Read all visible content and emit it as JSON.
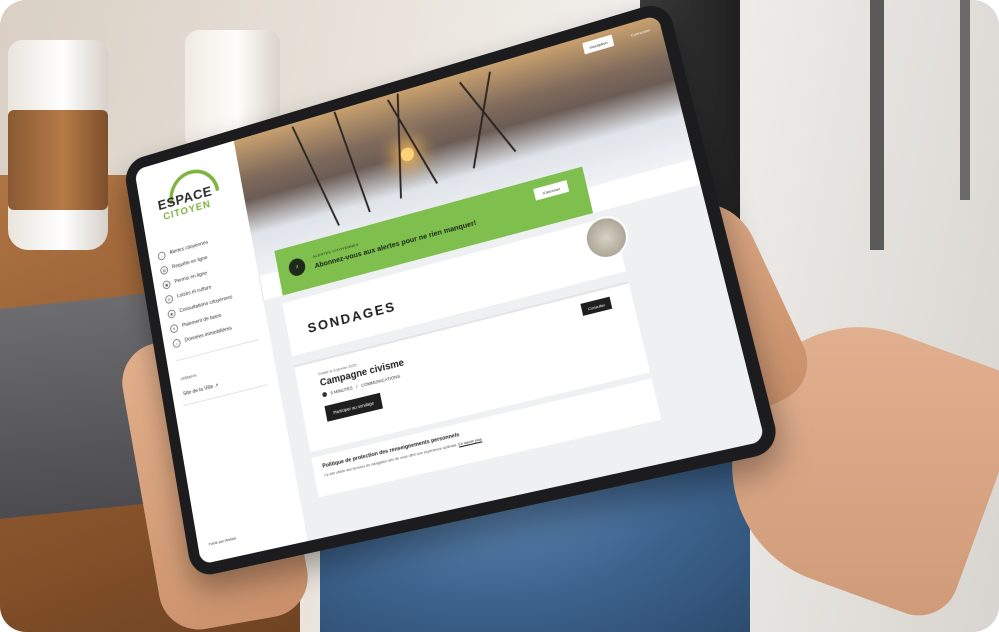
{
  "header": {
    "register_label": "Inscription",
    "login_label": "Connexion"
  },
  "logo": {
    "line1": "ESPACE",
    "line2": "CITOYEN"
  },
  "sidebar": {
    "items": [
      {
        "label": "Alertes citoyennes",
        "icon": "bell-icon"
      },
      {
        "label": "Requête en ligne",
        "icon": "document-icon"
      },
      {
        "label": "Permis en ligne",
        "icon": "permit-icon"
      },
      {
        "label": "Loisirs et culture",
        "icon": "leisure-icon"
      },
      {
        "label": "Consultations citoyennes",
        "icon": "consultation-icon"
      },
      {
        "label": "Paiement de taxes",
        "icon": "payment-icon"
      },
      {
        "label": "Données immobilières",
        "icon": "building-icon"
      }
    ],
    "section_label": "Utilitaires",
    "site_link": "Site de la Ville ↗",
    "footer_credit": "Fuelé par Webbit"
  },
  "alert": {
    "kicker": "ALERTES CITOYENNES",
    "title": "Abonnez-vous aux alertes pour ne rien manquer!",
    "button_label": "S'abonner"
  },
  "main": {
    "section_title": "SONDAGES",
    "poll": {
      "date": "Publié le 8 janvier 2025",
      "title": "Campagne civisme",
      "duration": "5 MINUTES",
      "separator": "/",
      "category": "COMMUNICATIONS",
      "participate_label": "Participer au sondage",
      "close_label": "Consulter"
    },
    "privacy": {
      "title": "Politique de protection des renseignements personnels",
      "body": "Ce site utilise des témoins de navigation afin de vous offrir une expérience optimale.",
      "link": "En savoir plus"
    }
  },
  "colors": {
    "accent": "#7fbf4e",
    "dark": "#1f1f1f"
  }
}
